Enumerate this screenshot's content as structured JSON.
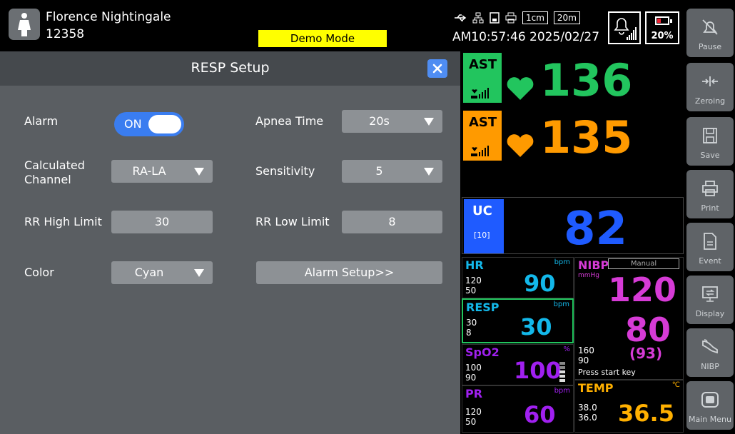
{
  "patient": {
    "name": "Florence Nightingale",
    "id": "12358",
    "icon": "person-icon"
  },
  "demo_mode": "Demo Mode",
  "status": {
    "scale1": "1cm",
    "scale2": "20m",
    "datetime": "AM10:57:46 2025/02/27",
    "battery": "20%"
  },
  "dialog": {
    "title": "RESP Setup",
    "fields": {
      "alarm": {
        "label": "Alarm",
        "value": "ON"
      },
      "apnea_time": {
        "label": "Apnea Time",
        "value": "20s"
      },
      "calc_channel": {
        "label_line1": "Calculated",
        "label_line2": "Channel",
        "value": "RA-LA"
      },
      "sensitivity": {
        "label": "Sensitivity",
        "value": "5"
      },
      "rr_high": {
        "label": "RR High Limit",
        "value": "30"
      },
      "rr_low": {
        "label": "RR Low Limit",
        "value": "8"
      },
      "color": {
        "label": "Color",
        "value": "Cyan"
      },
      "alarm_setup": {
        "label": "Alarm Setup>>"
      }
    }
  },
  "monitor": {
    "ast1": {
      "label": "AST",
      "value": "136",
      "color": "#22c55e"
    },
    "ast2": {
      "label": "AST",
      "value": "135",
      "color": "#ff9a00"
    },
    "uc": {
      "label": "UC",
      "sub": "[10]",
      "value": "82",
      "color": "#1f5bff"
    },
    "hr": {
      "label": "HR",
      "unit": "bpm",
      "high": "120",
      "low": "50",
      "value": "90",
      "color": "#13b8ea"
    },
    "resp": {
      "label": "RESP",
      "unit": "bpm",
      "high": "30",
      "low": "8",
      "value": "30",
      "color": "#13b8ea"
    },
    "spo2": {
      "label": "SpO2",
      "unit": "%",
      "high": "100",
      "low": "90",
      "value": "100",
      "color": "#a020f0"
    },
    "pr": {
      "label": "PR",
      "unit": "bpm",
      "high": "120",
      "low": "50",
      "value": "60",
      "color": "#a020f0"
    },
    "nibp": {
      "label": "NIBP",
      "mode": "Manual",
      "unit": "mmHg",
      "sys": "120",
      "dia": "80",
      "mean": "(93)",
      "high": "160",
      "low": "90",
      "hint": "Press start key",
      "color": "#d63bd6"
    },
    "temp": {
      "label": "TEMP",
      "unit": "℃",
      "high": "38.0",
      "low": "36.0",
      "value": "36.5",
      "color": "#ffb000"
    }
  },
  "menu": [
    {
      "label": "Pause",
      "icon": "alarm-pause-icon"
    },
    {
      "label": "Zeroing",
      "icon": "zeroing-icon"
    },
    {
      "label": "Save",
      "icon": "save-icon"
    },
    {
      "label": "Print",
      "icon": "print-icon"
    },
    {
      "label": "Event",
      "icon": "event-icon"
    },
    {
      "label": "Display",
      "icon": "display-icon"
    },
    {
      "label": "NIBP",
      "icon": "nibp-cuff-icon"
    },
    {
      "label": "Main Menu",
      "icon": "main-menu-icon"
    }
  ]
}
